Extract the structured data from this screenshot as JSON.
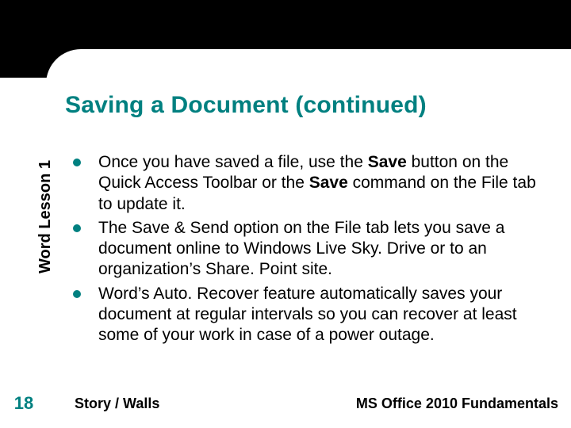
{
  "title": "Saving a Document (continued)",
  "sidebar_label": "Word Lesson 1",
  "bullets": [
    {
      "pre": "Once you have saved a file, use the ",
      "b1": "Save",
      "mid": " button on the Quick Access Toolbar or the ",
      "b2": "Save",
      "post": " command on the File tab to update it."
    },
    {
      "text": "The Save & Send option on the File tab lets you save a document online to Windows Live Sky. Drive or to an organization’s Share. Point site."
    },
    {
      "text": "Word’s Auto. Recover feature automatically saves your document at regular intervals so you can recover at least some of your work in case of a power outage."
    }
  ],
  "footer": {
    "slide_number": "18",
    "left": "Story / Walls",
    "right": "MS Office 2010 Fundamentals"
  }
}
